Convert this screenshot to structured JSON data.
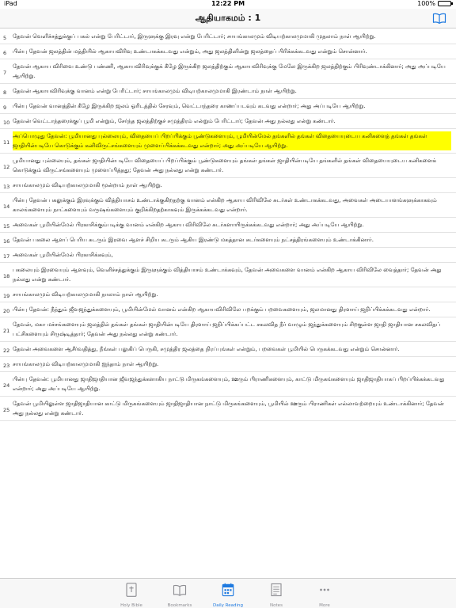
{
  "status_bar": {
    "carrier": "iPad",
    "time": "12:22 PM",
    "battery": "100%",
    "battery_level": 1.0
  },
  "header": {
    "title": "ஆதியாகமம் : 1"
  },
  "verses": [
    {
      "number": "5",
      "text": "தேவன் வெளிச்சத்துக்குப் பகல் என்று பேரிட்டார், இருளுக்கு இரவு என்று பேரிட்டார்; சாயங்காலமும் விடியற்காலமுமாகி முதலாம் நாள் ஆயிற்று."
    },
    {
      "number": "6",
      "text": "பின்பு தேவன் ஜலத்தின் மத்தியில் ஆகாயவிரிவு உண்டாகக்கடவது என்றும், அது ஜலத்தினின்று ஜலத்தைப் பிரிக்கக்கடவது என்றும் சொன்னார்."
    },
    {
      "number": "7",
      "text": "தேவன் ஆகாய விரிவை உண்டு பண்ணி, ஆகாயவிரிவுக்குக் கீழே இருக்கிற ஜலத்திற்கும் ஆகாயவிரிவுக்கு மேலே இருக்கிற ஜலத்திற்கும் பிரிவுண்டாக்கினார்; அது அப்படியே ஆயிற்று."
    },
    {
      "number": "8",
      "text": "தேவன் ஆகாயவிரிவுக்கு வானம் என்று பேரிட்டார்; சாயங்காலமும் விடியற்காலமுமாகி இரண்டாம் நாள் ஆயிற்று."
    },
    {
      "number": "9",
      "text": "பின்பு தேவன் வானத்தின் கீழே இருக்கிற ஜலம் ஓரிடத்தில் சேரவும், வெட்டாந்தரை காணப்படவும் கடவது என்றார்; அது அப்படியே ஆயிற்று."
    },
    {
      "number": "10",
      "text": "தேவன் வெட்டாந்தரைக்குப் பூமி என்றும், சேர்ந்த ஜலத்திற்குச் சமுத்திரம் என்றும் பேரிட்டார்; தேவன் அது நல்லது என்று கண்டார்."
    },
    {
      "number": "11",
      "highlight": true,
      "text": "அப்பொழுது தேவன்: பூமியானது புல்லையும், விதையைப் பிறப்பிக்கும் பூண்டுகளையும், பூமியின்மேல் தங்களில் தங்கள் விதையையுடைய கனிகளைத் தங்கள் தங்கள் ஜாதியின்படியே கொடுக்கும் கனிவிருட்சங்களையும் முளைப்பிக்கக்கடவது என்றார்; அது அப்படியே ஆயிற்று."
    },
    {
      "number": "12",
      "text": "பூமியானது புல்லையும், தங்கள் ஜாதியின்படியே விதையைப் பிறப்பிக்கும் பூண்டுகளையும் தங்கள் தங்கள் ஜாதியின்படியே தங்களில் தங்கள் விதையையுடைய கனிகளைக் கொடுக்கும் விருட்சங்களையும் முளைப்பித்தது; தேவன் அது நல்லது என்று கண்டார்."
    },
    {
      "number": "13",
      "text": "சாயங்காலமும் விடியற்காலமுமாகி மூன்றாம் நாள் ஆயிற்று."
    },
    {
      "number": "14",
      "text": "பின்பு தேவன் பகலுக்கும் இரவுக்கும் வித்தியாசம் உண்டாக்குகிறதற்கு வானம் என்கிற ஆகாய விரிவிலே சுடர்கள் உண்டாகக்கடவது, அவைகள் அடையாளங்களுக்காகவும் காலங்களையும் நாட்களையும் வருஷங்களையும் குறிக்கிறதற்காகவும் இருக்கக்கடவது என்றார்."
    },
    {
      "number": "15",
      "text": "அவைகள் பூமியின்மேல் பிரகாசிக்கும்படிக்கு வானம் என்கிற ஆகாய விரிவிலே சுடர்களாயிருக்கக்கடவது என்றார்; அது அப்படியே ஆயிற்று."
    },
    {
      "number": "16",
      "text": "தேவன் பகலை ஆளப் பெரிய சுடரும் இரவை ஆளச் சிறிய சுடரும் ஆகிய இரண்டு மகத்தான சுடர்களையும் நட்சத்திரங்களையும் உண்டாக்கினார்."
    },
    {
      "number": "17",
      "text": "அவைகள் பூமியின்மேல் பிரகாசிக்கவும்,"
    },
    {
      "number": "18",
      "text": "பகலையும் இரவையும் ஆளவும், வெளிச்சத்துக்கும் இருளுக்கும் வித்தியாசம் உண்டாக்கவும், தேவன் அவைகளை வானம் என்கிற ஆகாய விரிவிலே வைத்தார்; தேவன் அது நல்லது என்று கண்டார்."
    },
    {
      "number": "19",
      "text": "சாயங்காலமும் விடியற்காலமுமாகி நாலாம் நாள் ஆயிற்று."
    },
    {
      "number": "20",
      "text": "பின்பு தேவன்: நீந்தும் ஜீவஜந்துக்களையும், பூமியின்மேல் வானம் என்கிற ஆகாயவிரிவிலே பறக்கும் பறவைகளையும், ஜலமானது திரளாய் ஜநிப்பிக்கக்கடவது என்றார்."
    },
    {
      "number": "21",
      "text": "தேவன், மகா மச்சங்களையும் ஜலத்தில் தங்கள் தங்கள் ஜாதியின்படியே திரளாய் ஜநிப்பிக்கப்பட்ட சகலவித நீர் வாழும் ஜந்துக்களையும் சிறகுள்ள ஜாதி ஜாதியான சகலவிதப் பட்சிகளையும் சிருஷ்டித்தார்; தேவன் அது நல்லது என்று கண்டார்."
    },
    {
      "number": "22",
      "text": "தேவன் அவைகளை ஆசீர்வதித்து, நீங்கள் பலுகிப் பெருகி, சமுத்திர ஜலத்தை நிரப்புங்கள் என்றும், பறவைகள் பூமியில் பெருகக்கடவது என்றும் சொன்னார்."
    },
    {
      "number": "23",
      "text": "சாயங்காலமும் விடியற்காலமுமாகி ஐந்தாம் நாள் ஆயிற்று."
    },
    {
      "number": "24",
      "text": "பின்பு தேவன்: பூமியானது ஜாதிஜாதியான ஜீவஜந்துக்களாகிய நாட்டு மிருகங்களையும், ஊரும் பிராணிகளையும், காட்டு மிருகங்களையும் ஜாதிஜாதியாகப் பிறப்பிக்கக்கடவது என்றார்; அது அப்படியே ஆயிற்று."
    },
    {
      "number": "25",
      "text": "தேவன் பூமியிலுள்ள ஜாதிஜாதியான காட்டு மிருகங்களையும் ஜாதிஜாதியான நாட்டு மிருகங்களையும், பூமியில் ஊரும் பிராணிகள் எல்லாவற்றையும் உண்டாக்கினார்; தேவன் அது நல்லது என்று கண்டார்."
    }
  ],
  "tabs": [
    {
      "id": "holy-bible",
      "label": "Holy Bible",
      "icon": "bible-icon",
      "active": false
    },
    {
      "id": "bookmarks",
      "label": "Bookmarks",
      "icon": "bookmarks-icon",
      "active": false
    },
    {
      "id": "daily-reading",
      "label": "Daily Reading",
      "icon": "calendar-icon",
      "active": true
    },
    {
      "id": "notes",
      "label": "Notes",
      "icon": "notes-icon",
      "active": false
    },
    {
      "id": "more",
      "label": "More",
      "icon": "more-icon",
      "active": false
    }
  ],
  "colors": {
    "accent": "#1f7ae0",
    "highlight": "#ffff00",
    "inactive_tab": "#8e8e93"
  }
}
